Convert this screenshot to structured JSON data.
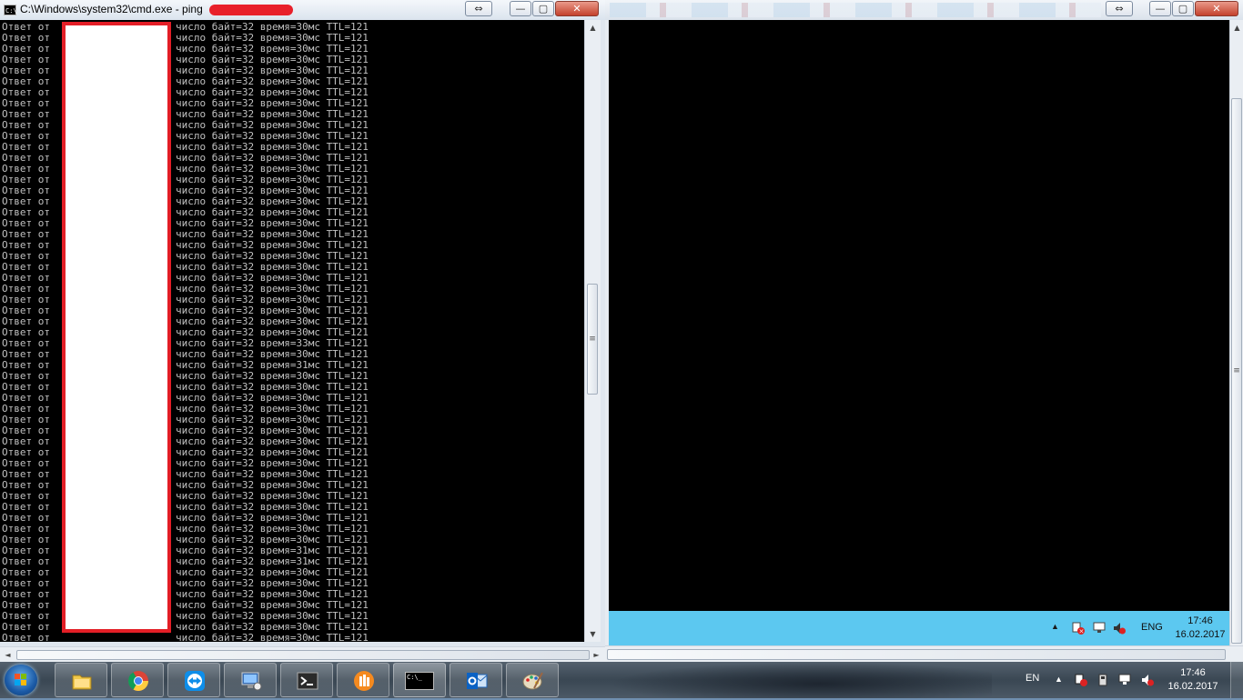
{
  "cmd_window": {
    "title": "C:\\Windows\\system32\\cmd.exe - ping",
    "icon_text": "C:\\",
    "controls": {
      "restore": "⇔",
      "minimize": "—",
      "maximize": "▢",
      "close": "✕"
    },
    "col1": "Ответ от",
    "lines": [
      "число байт=32 время=30мс TTL=121",
      "число байт=32 время=30мс TTL=121",
      "число байт=32 время=30мс TTL=121",
      "число байт=32 время=30мс TTL=121",
      "число байт=32 время=30мс TTL=121",
      "число байт=32 время=30мс TTL=121",
      "число байт=32 время=30мс TTL=121",
      "число байт=32 время=30мс TTL=121",
      "число байт=32 время=30мс TTL=121",
      "число байт=32 время=30мс TTL=121",
      "число байт=32 время=30мс TTL=121",
      "число байт=32 время=30мс TTL=121",
      "число байт=32 время=30мс TTL=121",
      "число байт=32 время=30мс TTL=121",
      "число байт=32 время=30мс TTL=121",
      "число байт=32 время=30мс TTL=121",
      "число байт=32 время=30мс TTL=121",
      "число байт=32 время=30мс TTL=121",
      "число байт=32 время=30мс TTL=121",
      "число байт=32 время=30мс TTL=121",
      "число байт=32 время=30мс TTL=121",
      "число байт=32 время=30мс TTL=121",
      "число байт=32 время=30мс TTL=121",
      "число байт=32 время=30мс TTL=121",
      "число байт=32 время=30мс TTL=121",
      "число байт=32 время=30мс TTL=121",
      "число байт=32 время=30мс TTL=121",
      "число байт=32 время=30мс TTL=121",
      "число байт=32 время=30мс TTL=121",
      "число байт=32 время=33мс TTL=121",
      "число байт=32 время=30мс TTL=121",
      "число байт=32 время=31мс TTL=121",
      "число байт=32 время=30мс TTL=121",
      "число байт=32 время=30мс TTL=121",
      "число байт=32 время=30мс TTL=121",
      "число байт=32 время=30мс TTL=121",
      "число байт=32 время=30мс TTL=121",
      "число байт=32 время=30мс TTL=121",
      "число байт=32 время=30мс TTL=121",
      "число байт=32 время=30мс TTL=121",
      "число байт=32 время=30мс TTL=121",
      "число байт=32 время=30мс TTL=121",
      "число байт=32 время=30мс TTL=121",
      "число байт=32 время=30мс TTL=121",
      "число байт=32 время=30мс TTL=121",
      "число байт=32 время=30мс TTL=121",
      "число байт=32 время=30мс TTL=121",
      "число байт=32 время=30мс TTL=121",
      "число байт=32 время=31мс TTL=121",
      "число байт=32 время=31мс TTL=121",
      "число байт=32 время=30мс TTL=121",
      "число байт=32 время=30мс TTL=121",
      "число байт=32 время=30мс TTL=121",
      "число байт=32 время=30мс TTL=121",
      "число байт=32 время=30мс TTL=121",
      "число байт=32 время=30мс TTL=121",
      "число байт=32 время=30мс TTL=121"
    ]
  },
  "scrollbar": {
    "up": "▲",
    "down": "▼",
    "left": "◄",
    "right": "►",
    "grip": "≡"
  },
  "rdp_window": {
    "controls": {
      "restore": "⇔",
      "minimize": "—",
      "maximize": "▢",
      "close": "✕"
    },
    "lang": "ENG",
    "time": "17:46",
    "date": "16.02.2017",
    "tray_up": "▲"
  },
  "taskbar": {
    "apps": [
      "file-explorer",
      "google-chrome",
      "teamviewer",
      "remote-desktop",
      "powershell",
      "app-orange",
      "command-prompt",
      "outlook",
      "paint"
    ],
    "cmd_icon_text": "C:\\_",
    "lang": "EN",
    "time": "17:46",
    "date": "16.02.2017",
    "tray_up": "▲"
  },
  "colors": {
    "console_bg": "#000000",
    "console_fg": "#c0c0c0",
    "redact": "#e31e26",
    "rdp_taskbar": "#5cc8f0"
  }
}
